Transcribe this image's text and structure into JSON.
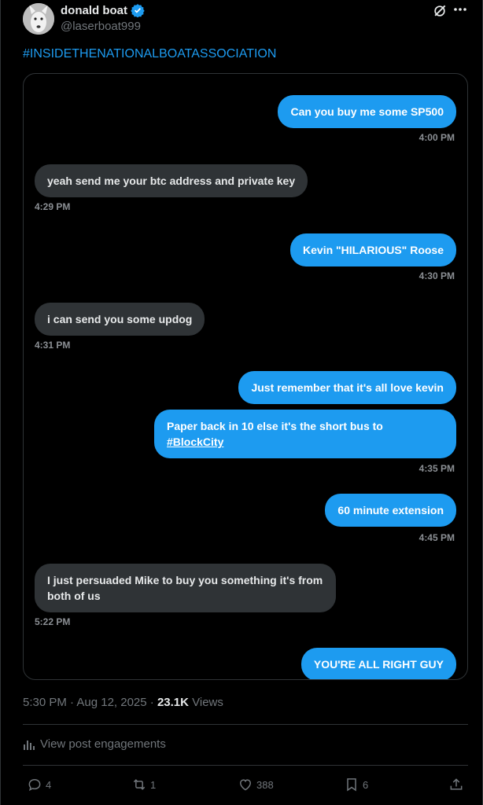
{
  "author": {
    "display_name": "donald boat",
    "handle": "@laserboat999"
  },
  "post": {
    "hashtag": "#INSIDETHENATIONALBOATASSOCIATION",
    "timestamp": "5:30 PM · Aug 12, 2025 · ",
    "views_count": "23.1K",
    "views_label": " Views",
    "engagements_link": "View post engagements"
  },
  "chat": {
    "messages": [
      {
        "text": "Can you buy me some SP500",
        "time": "4:00 PM"
      },
      {
        "text": "yeah send me your btc address and private key",
        "time": "4:29 PM"
      },
      {
        "text": "Kevin \"HILARIOUS\" Roose",
        "time": "4:30 PM"
      },
      {
        "text": "i can send you some updog",
        "time": "4:31 PM"
      },
      {
        "text": "Just remember that it's all love kevin"
      },
      {
        "text_part1": "Paper back in 10 else it's the short bus to",
        "link": "#BlockCity",
        "time": "4:35 PM"
      },
      {
        "text": "60 minute extension",
        "time": "4:45 PM"
      },
      {
        "text": "I just persuaded Mike to buy you something it's from both of us",
        "time": "5:22 PM"
      },
      {
        "text": "YOU'RE ALL RIGHT GUY"
      }
    ]
  },
  "actions": {
    "replies": "4",
    "reposts": "1",
    "likes": "388",
    "bookmarks": "6"
  },
  "icons": {
    "verified": "verified-badge-icon",
    "grok": "grok-icon",
    "more": "more-icon",
    "engagements": "analytics-icon",
    "reply": "reply-icon",
    "repost": "repost-icon",
    "like": "heart-icon",
    "bookmark": "bookmark-icon",
    "share": "share-icon"
  },
  "colors": {
    "accent": "#1d9bf0",
    "received_bubble": "#2f3336"
  }
}
